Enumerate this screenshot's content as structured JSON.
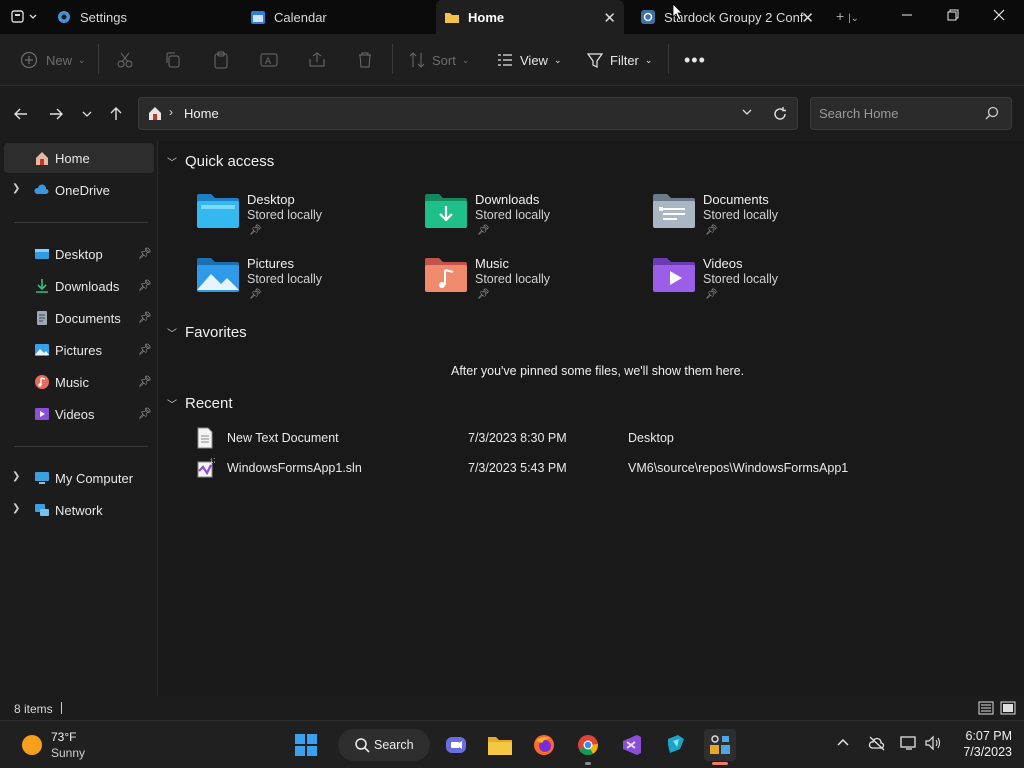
{
  "tabs": [
    {
      "label": "Settings"
    },
    {
      "label": "Calendar"
    },
    {
      "label": "Home"
    },
    {
      "label": "Stardock Groupy 2 Conf..."
    }
  ],
  "toolbar": {
    "new_label": "New",
    "sort_label": "Sort",
    "view_label": "View",
    "filter_label": "Filter"
  },
  "address": {
    "crumb": "Home",
    "search_placeholder": "Search Home"
  },
  "sidebar": {
    "items": [
      {
        "label": "Home"
      },
      {
        "label": "OneDrive"
      },
      {
        "label": "Desktop"
      },
      {
        "label": "Downloads"
      },
      {
        "label": "Documents"
      },
      {
        "label": "Pictures"
      },
      {
        "label": "Music"
      },
      {
        "label": "Videos"
      },
      {
        "label": "My Computer"
      },
      {
        "label": "Network"
      }
    ]
  },
  "main": {
    "quick_access_title": "Quick access",
    "favorites_title": "Favorites",
    "favorites_empty": "After you've pinned some files, we'll show them here.",
    "recent_title": "Recent",
    "quick_items": [
      {
        "name": "Desktop",
        "sub": "Stored locally"
      },
      {
        "name": "Downloads",
        "sub": "Stored locally"
      },
      {
        "name": "Documents",
        "sub": "Stored locally"
      },
      {
        "name": "Pictures",
        "sub": "Stored locally"
      },
      {
        "name": "Music",
        "sub": "Stored locally"
      },
      {
        "name": "Videos",
        "sub": "Stored locally"
      }
    ],
    "recent": [
      {
        "name": "New Text Document",
        "date": "7/3/2023 8:30 PM",
        "location": "Desktop"
      },
      {
        "name": "WindowsFormsApp1.sln",
        "date": "7/3/2023 5:43 PM",
        "location": "VM6\\source\\repos\\WindowsFormsApp1"
      }
    ]
  },
  "status": {
    "items_count": "8 items"
  },
  "taskbar": {
    "weather_temp": "73°F",
    "weather_desc": "Sunny",
    "search_label": "Search",
    "time": "6:07 PM",
    "date": "7/3/2023"
  },
  "colors": {
    "accent": "#60cdff",
    "background": "#191919",
    "sidebar_selected": "#2d2d2d"
  }
}
